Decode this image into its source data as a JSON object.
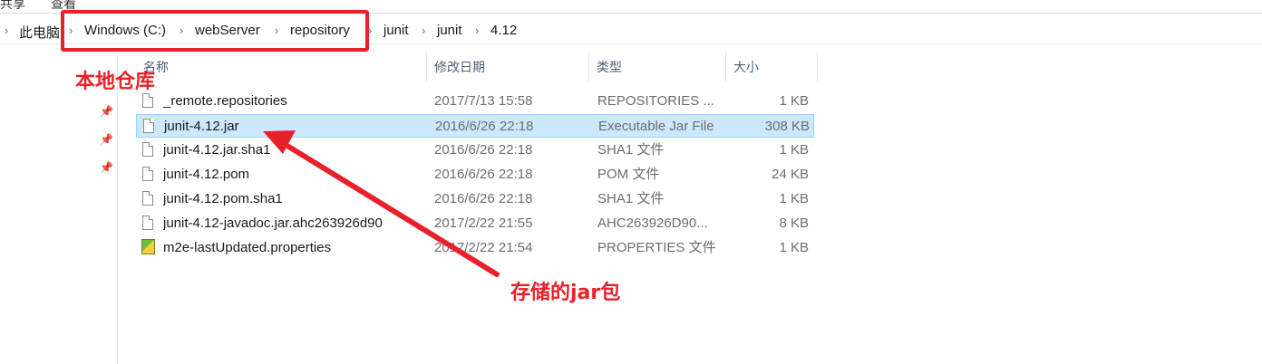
{
  "ribbon": {
    "tab1": "共享",
    "tab2": "查看"
  },
  "breadcrumb": [
    "此电脑",
    "Windows (C:)",
    "webServer",
    "repository",
    "junit",
    "junit",
    "4.12"
  ],
  "columns": {
    "name": "名称",
    "date": "修改日期",
    "type": "类型",
    "size": "大小"
  },
  "files": [
    {
      "name": "_remote.repositories",
      "date": "2017/7/13 15:58",
      "type": "REPOSITORIES ...",
      "size": "1 KB",
      "icon": "file-icon"
    },
    {
      "name": "junit-4.12.jar",
      "date": "2016/6/26 22:18",
      "type": "Executable Jar File",
      "size": "308 KB",
      "icon": "file-icon"
    },
    {
      "name": "junit-4.12.jar.sha1",
      "date": "2016/6/26 22:18",
      "type": "SHA1 文件",
      "size": "1 KB",
      "icon": "file-icon"
    },
    {
      "name": "junit-4.12.pom",
      "date": "2016/6/26 22:18",
      "type": "POM 文件",
      "size": "24 KB",
      "icon": "file-icon"
    },
    {
      "name": "junit-4.12.pom.sha1",
      "date": "2016/6/26 22:18",
      "type": "SHA1 文件",
      "size": "1 KB",
      "icon": "file-icon"
    },
    {
      "name": "junit-4.12-javadoc.jar.ahc263926d90",
      "date": "2017/2/22 21:55",
      "type": "AHC263926D90...",
      "size": "8 KB",
      "icon": "file-icon"
    },
    {
      "name": "m2e-lastUpdated.properties",
      "date": "2017/2/22 21:54",
      "type": "PROPERTIES 文件",
      "size": "1 KB",
      "icon": "properties-icon"
    }
  ],
  "annotations": {
    "local_repo": "本地仓库",
    "stored_jar": "存储的jar包"
  },
  "colors": {
    "annotation": "#e8202a",
    "selection": "#cce8ff"
  }
}
